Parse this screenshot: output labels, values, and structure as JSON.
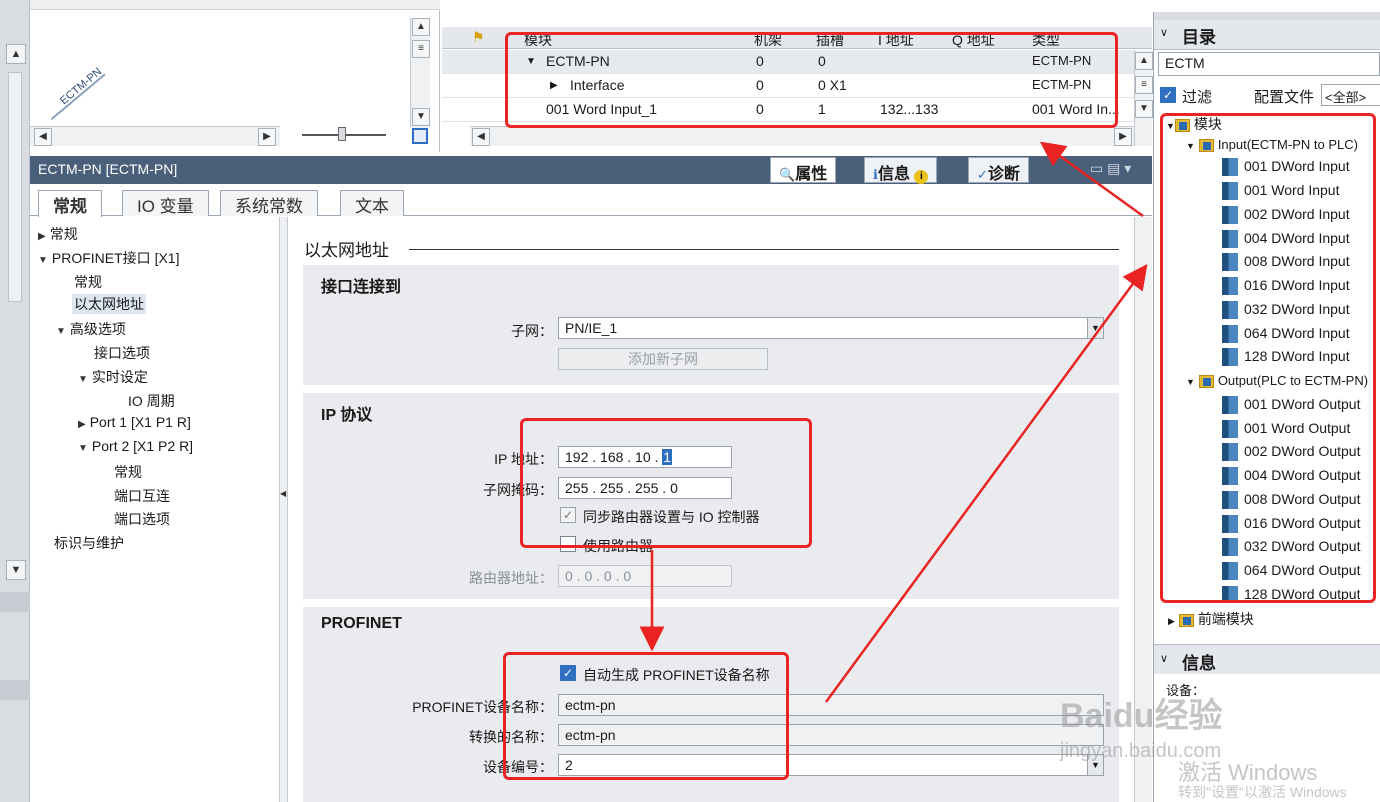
{
  "top_canvas": {
    "device_label": "ECTM-PN"
  },
  "device_overview": {
    "columns": [
      "模块",
      "机架",
      "插槽",
      "I 地址",
      "Q 地址",
      "类型"
    ],
    "rows": [
      {
        "name": "ECTM-PN",
        "rack": "0",
        "slot": "0",
        "i_addr": "",
        "q_addr": "",
        "type": "ECTM-PN",
        "expand": "▼"
      },
      {
        "name": "Interface",
        "rack": "0",
        "slot": "0 X1",
        "i_addr": "",
        "q_addr": "",
        "type": "ECTM-PN",
        "expand": "▶"
      },
      {
        "name": "001 Word Input_1",
        "rack": "0",
        "slot": "1",
        "i_addr": "132...133",
        "q_addr": "",
        "type": "001 Word In...",
        "expand": ""
      }
    ]
  },
  "inspector": {
    "title": "ECTM-PN [ECTM-PN]",
    "tabs": [
      "属性",
      "信息",
      "诊断"
    ],
    "property_tabs": [
      "常规",
      "IO 变量",
      "系统常数",
      "文本"
    ]
  },
  "nav_tree": [
    {
      "label": "常规",
      "indent": 0,
      "tri": "▶"
    },
    {
      "label": "PROFINET接口 [X1]",
      "indent": 0,
      "tri": "▼"
    },
    {
      "label": "常规",
      "indent": 1,
      "tri": ""
    },
    {
      "label": "以太网地址",
      "indent": 1,
      "tri": "",
      "selected": true
    },
    {
      "label": "高级选项",
      "indent": 1,
      "tri": "▼"
    },
    {
      "label": "接口选项",
      "indent": 2,
      "tri": ""
    },
    {
      "label": "实时设定",
      "indent": 2,
      "tri": "▼"
    },
    {
      "label": "IO 周期",
      "indent": 3,
      "tri": ""
    },
    {
      "label": "Port 1 [X1 P1 R]",
      "indent": 2,
      "tri": "▶"
    },
    {
      "label": "Port 2 [X1 P2 R]",
      "indent": 2,
      "tri": "▼"
    },
    {
      "label": "常规",
      "indent": 3,
      "tri": ""
    },
    {
      "label": "端口互连",
      "indent": 3,
      "tri": ""
    },
    {
      "label": "端口选项",
      "indent": 3,
      "tri": ""
    },
    {
      "label": "标识与维护",
      "indent": 0,
      "tri": ""
    }
  ],
  "content": {
    "heading": "以太网地址",
    "interface_section": {
      "title": "接口连接到",
      "subnet_label": "子网：",
      "subnet_value": "PN/IE_1",
      "add_subnet_button": "添加新子网"
    },
    "ip_section": {
      "title": "IP 协议",
      "ip_label": "IP 地址：",
      "ip_value": "192 . 168 . 10 .",
      "ip_last": "1",
      "mask_label": "子网掩码：",
      "mask_value": "255 . 255 . 255 . 0",
      "sync_router_label": "同步路由器设置与 IO 控制器",
      "use_router_label": "使用路由器",
      "router_addr_label": "路由器地址：",
      "router_addr_value": "0   . 0   . 0   . 0"
    },
    "profinet_section": {
      "title": "PROFINET",
      "auto_name_label": "自动生成 PROFINET设备名称",
      "device_name_label": "PROFINET设备名称：",
      "device_name_value": "ectm-pn",
      "converted_name_label": "转换的名称：",
      "converted_name_value": "ectm-pn",
      "device_number_label": "设备编号：",
      "device_number_value": "2"
    }
  },
  "catalog": {
    "title": "目录",
    "search_value": "ECTM",
    "filter_label": "过滤",
    "profile_label": "配置文件",
    "profile_value": "<全部>",
    "root": "模块",
    "input_folder": "Input(ECTM-PN to PLC)",
    "input_items": [
      "001 DWord Input",
      "001 Word Input",
      "002 DWord Input",
      "004 DWord Input",
      "008 DWord Input",
      "016 DWord Input",
      "032 DWord Input",
      "064 DWord Input",
      "128 DWord Input"
    ],
    "output_folder": "Output(PLC to ECTM-PN)",
    "output_items": [
      "001 DWord Output",
      "001 Word Output",
      "002 DWord Output",
      "004 DWord Output",
      "008 DWord Output",
      "016 DWord Output",
      "032 DWord Output",
      "064 DWord Output",
      "128 DWord Output"
    ],
    "front_modules": "前端模块",
    "info_title": "信息",
    "info_device": "设备："
  },
  "watermark": {
    "brand": "Baidu经验",
    "url": "jingyan.baidu.com",
    "activate_title": "激活 Windows",
    "activate_sub": "转到\"设置\"以激活 Windows"
  },
  "colors": {
    "annotation_red": "#ea2323",
    "title_bar": "#4a5f79",
    "checkbox_blue": "#2e6fc1"
  }
}
